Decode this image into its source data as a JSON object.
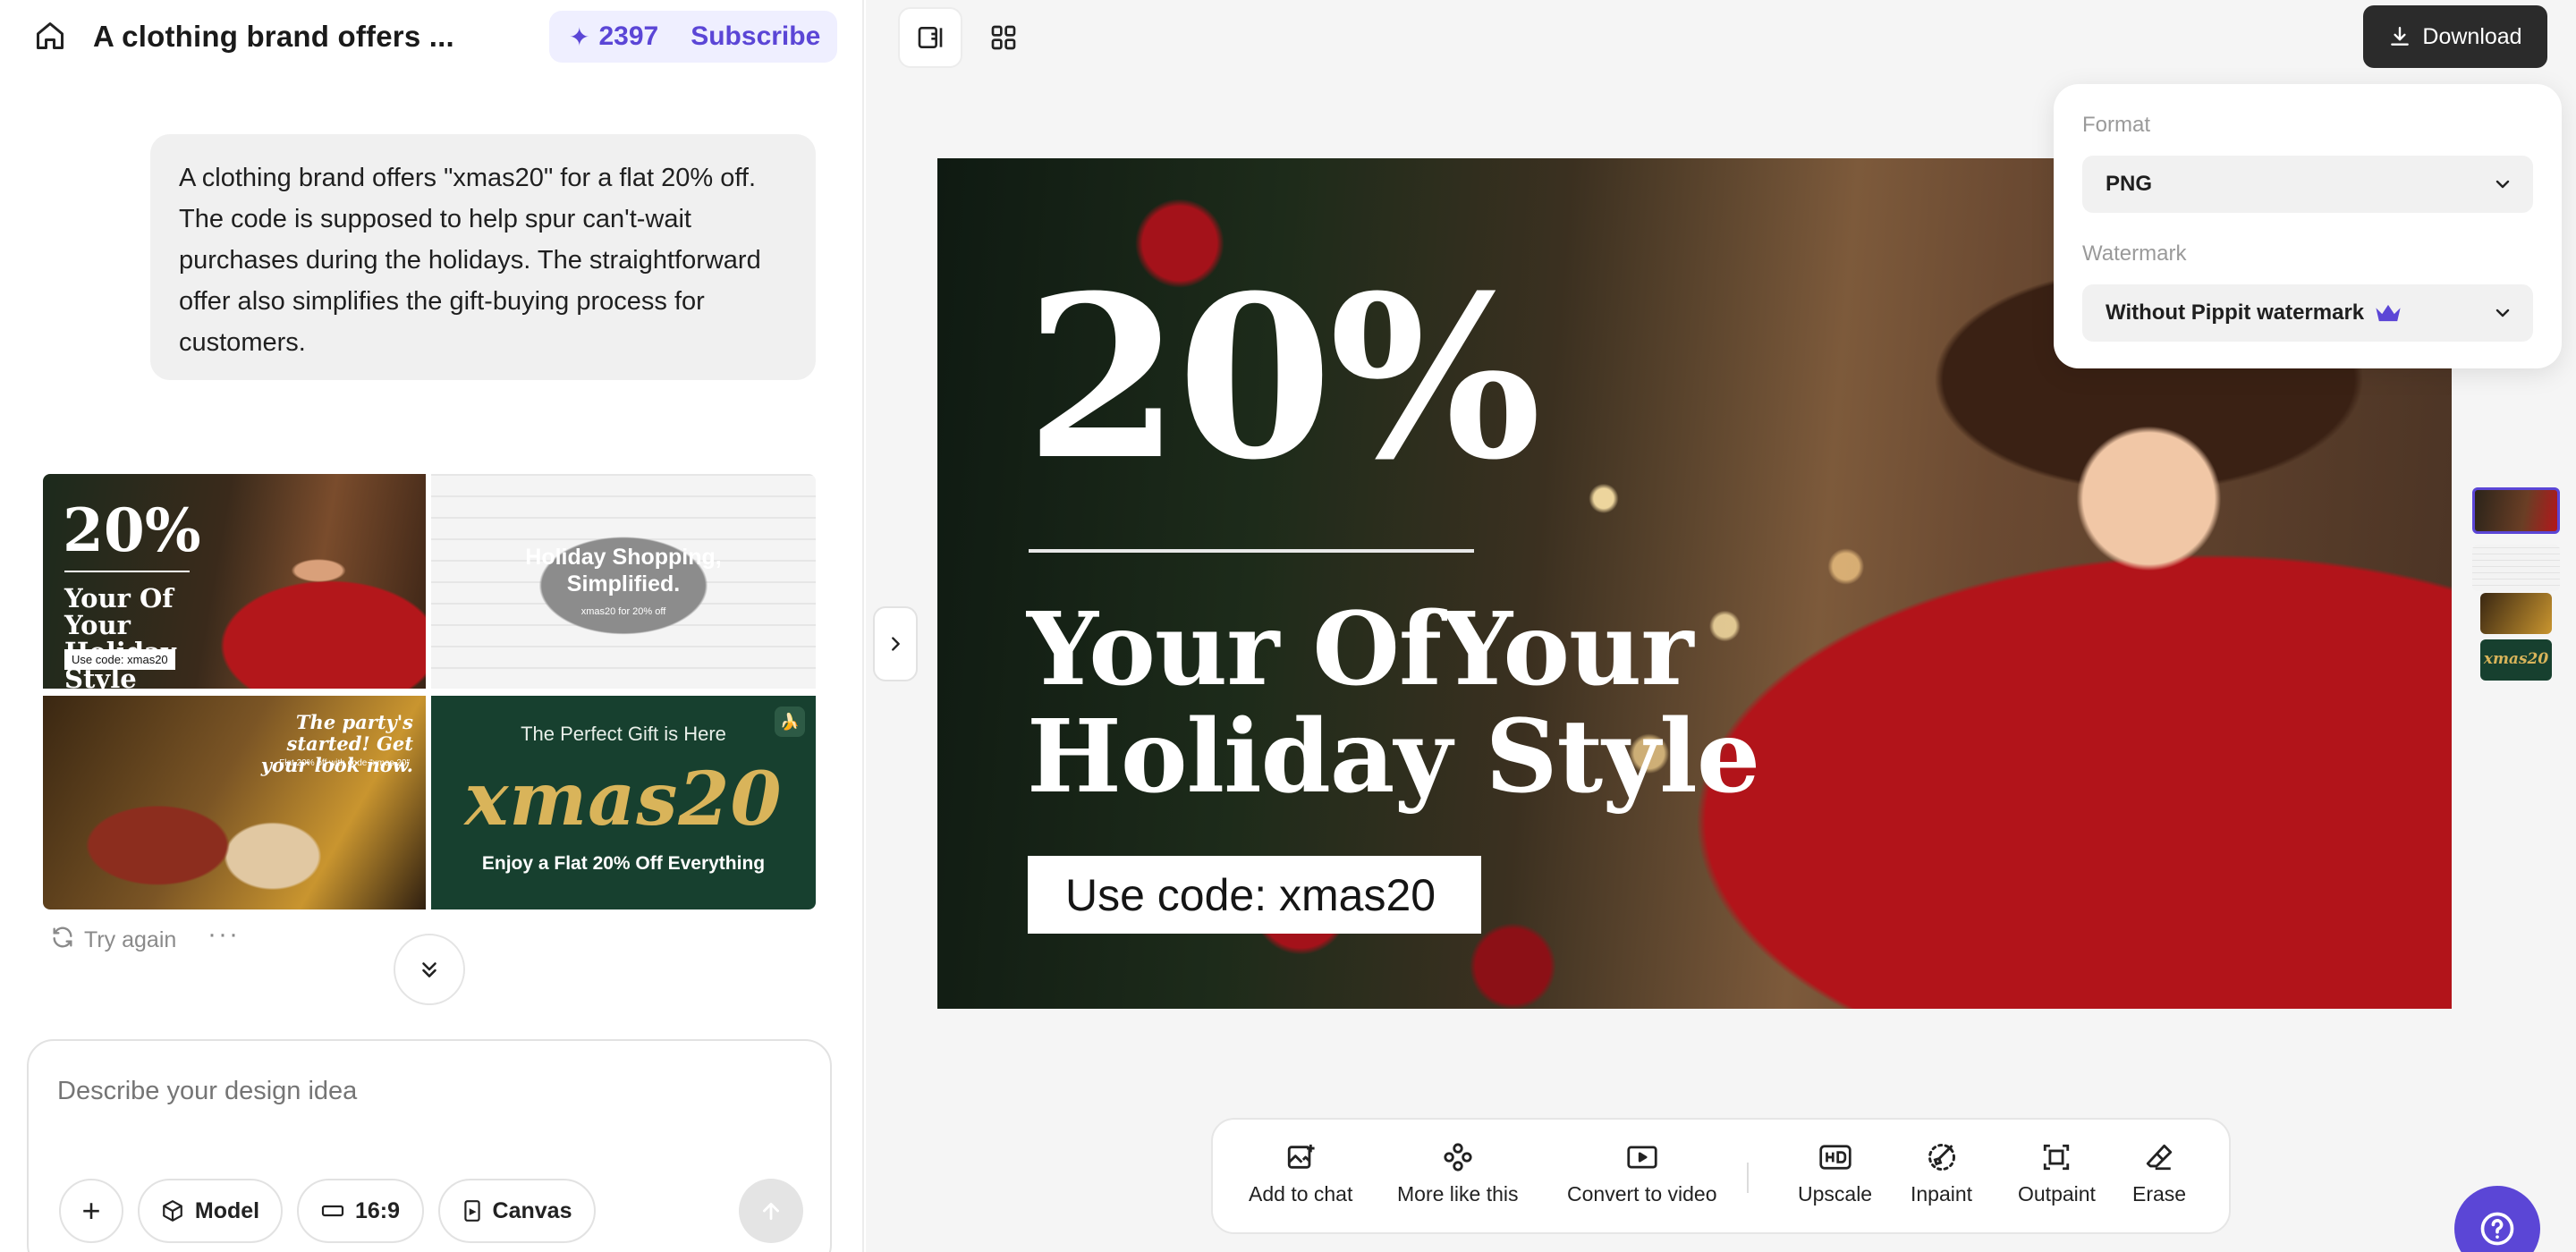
{
  "header": {
    "title": "A clothing brand offers ...",
    "credits": "2397",
    "subscribe_label": "Subscribe"
  },
  "chat": {
    "message": "A clothing brand offers \"xmas20\" for a flat 20% off. The code  is supposed to help spur can't-wait purchases during the holidays. The straightforward offer  also simplifies the gift-buying process for customers.",
    "try_again_label": "Try again",
    "results": [
      {
        "big": "20%",
        "headline": "Your Of Your Holiday Style",
        "code": "Use code: xmas20"
      },
      {
        "headline": "Holiday Shopping, Simplified.",
        "sub": "xmas20 for 20% off"
      },
      {
        "headline": "The party's started! Get your look now.",
        "sub": "Flat 20% off with code \"xmas 20\""
      },
      {
        "top": "The Perfect Gift is Here",
        "big": "xmas20",
        "bottom": "Enjoy a Flat 20% Off Everything"
      }
    ]
  },
  "composer": {
    "placeholder": "Describe your design idea",
    "model_label": "Model",
    "ratio_label": "16:9",
    "canvas_label": "Canvas"
  },
  "canvas": {
    "big": "20%",
    "headline_1": "Your OfYour",
    "headline_2": "Holiday Style",
    "code": "Use code: xmas20"
  },
  "thumb_rail": {
    "fourth_label": "xmas20"
  },
  "download": {
    "button_label": "Download",
    "format_label": "Format",
    "format_value": "PNG",
    "watermark_label": "Watermark",
    "watermark_value": "Without Pippit watermark"
  },
  "toolbar": {
    "add_to_chat": "Add to chat",
    "more_like_this": "More like this",
    "convert_to_video": "Convert to video",
    "upscale": "Upscale",
    "inpaint": "Inpaint",
    "outpaint": "Outpaint",
    "erase": "Erase"
  },
  "colors": {
    "accent": "#5b46d6",
    "download_bg": "#2b2b2b",
    "panel_bg": "#f5f5f5"
  }
}
